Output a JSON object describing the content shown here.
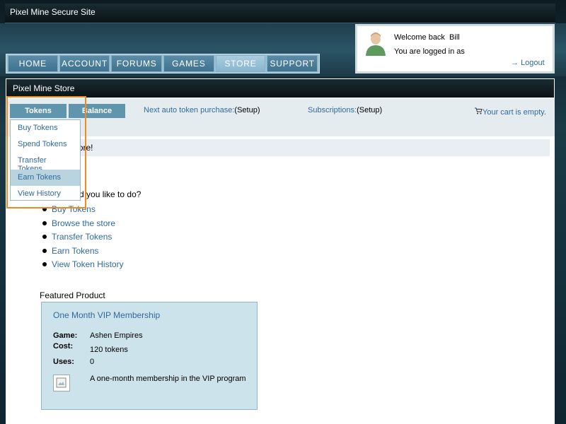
{
  "site": {
    "title": "Pixel Mine Secure Site"
  },
  "login": {
    "welcome": "Welcome back  Bill",
    "logged_in": "You are logged in as",
    "logout": "Logout",
    "logout_arrow": "→"
  },
  "nav": {
    "items": [
      {
        "label": "HOME"
      },
      {
        "label": "ACCOUNT"
      },
      {
        "label": "FORUMS"
      },
      {
        "label": "GAMES"
      },
      {
        "label": "STORE",
        "active": true
      },
      {
        "label": "SUPPORT"
      }
    ]
  },
  "store": {
    "header": "Pixel Mine Store",
    "tabs": {
      "tokens": "Tokens",
      "balance": "Balance"
    },
    "auto_token": {
      "link": "Next auto token purchase:",
      "setup": "(Setup)"
    },
    "subscriptions": {
      "link": "Subscriptions:",
      "setup": "(Setup)"
    },
    "cart": "Your cart is empty.",
    "welcome": "Welcome to the store!",
    "question": "What would you like to do?",
    "actions": [
      "Buy Tokens",
      "Browse the store",
      "Transfer Tokens",
      "Earn Tokens",
      "View Token History"
    ],
    "featured": {
      "label": "Featured Product",
      "title": "One Month VIP Membership",
      "game_label": "Game:",
      "game": "Ashen Empires",
      "cost_label": "Cost:",
      "cost": "120 tokens",
      "uses_label": "Uses:",
      "uses": "0",
      "description": "A one-month membership in the VIP program"
    }
  },
  "dropdown": {
    "items": [
      "Buy Tokens",
      "Spend Tokens",
      "Transfer Tokens",
      "Earn Tokens",
      "View History"
    ],
    "hovered_index": 3
  },
  "colors": {
    "link": "#2f69a0",
    "highlight_border": "#ef8a1f",
    "nav_active": "#aacde0",
    "tab_bg": "#5f96ad"
  }
}
